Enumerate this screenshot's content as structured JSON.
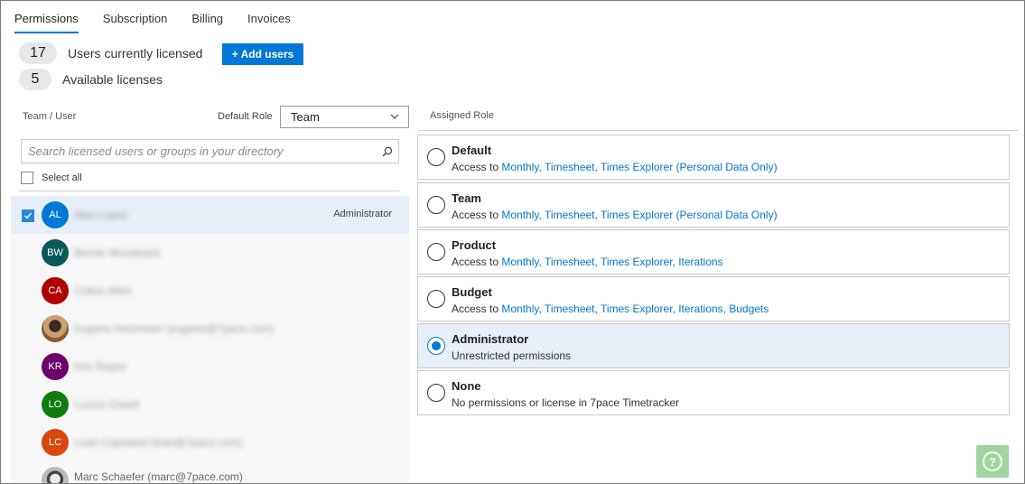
{
  "tabs": [
    {
      "label": "Permissions",
      "active": true
    },
    {
      "label": "Subscription",
      "active": false
    },
    {
      "label": "Billing",
      "active": false
    },
    {
      "label": "Invoices",
      "active": false
    }
  ],
  "licenses": {
    "licensed_count": "17",
    "licensed_label": "Users currently licensed",
    "available_count": "5",
    "available_label": "Available licenses",
    "add_users_label": "+ Add users"
  },
  "left_panel": {
    "team_user_header": "Team / User",
    "default_role_label": "Default Role",
    "default_role_value": "Team",
    "search_placeholder": "Search licensed users or groups in your directory",
    "select_all_label": "Select all"
  },
  "users": [
    {
      "initials": "AL",
      "name": "Alex Lopez",
      "role": "Administrator",
      "color": "#0078d4",
      "selected": true,
      "photo": ""
    },
    {
      "initials": "BW",
      "name": "Bernie Woodward",
      "role": "",
      "color": "#0b5a5a",
      "selected": false,
      "photo": ""
    },
    {
      "initials": "CA",
      "name": "Colton Allen",
      "role": "",
      "color": "#b00000",
      "selected": false,
      "photo": ""
    },
    {
      "initials": "",
      "name": "Eugene Holzmeier (eugene@7pace.com)",
      "role": "",
      "color": "#c9a070",
      "selected": false,
      "photo": "photo"
    },
    {
      "initials": "KR",
      "name": "Kim Raylor",
      "role": "",
      "color": "#6b006b",
      "selected": false,
      "photo": ""
    },
    {
      "initials": "LO",
      "name": "Lucius Orwell",
      "role": "",
      "color": "#107c10",
      "selected": false,
      "photo": ""
    },
    {
      "initials": "LC",
      "name": "Leah Copeland (leah@7pace.com)",
      "role": "",
      "color": "#d9480f",
      "selected": false,
      "photo": ""
    },
    {
      "initials": "",
      "name": "Marc Schaefer (marc@7pace.com)",
      "role": "",
      "color": "#444444",
      "selected": false,
      "photo": "photo2"
    }
  ],
  "right_panel": {
    "assigned_role_header": "Assigned Role",
    "roles": [
      {
        "name": "Default",
        "prefix": "Access to ",
        "links": "Monthly, Timesheet, Times Explorer (Personal Data Only)",
        "selected": false
      },
      {
        "name": "Team",
        "prefix": "Access to ",
        "links": "Monthly, Timesheet, Times Explorer (Personal Data Only)",
        "selected": false
      },
      {
        "name": "Product",
        "prefix": "Access to ",
        "links": "Monthly, Timesheet, Times Explorer, Iterations",
        "selected": false
      },
      {
        "name": "Budget",
        "prefix": "Access to ",
        "links": "Monthly, Timesheet, Times Explorer, Iterations, Budgets",
        "selected": false
      },
      {
        "name": "Administrator",
        "prefix": "Unrestricted permissions",
        "links": "",
        "selected": true
      },
      {
        "name": "None",
        "prefix": "No permissions or license in 7pace Timetracker",
        "links": "",
        "selected": false
      }
    ]
  },
  "help": {
    "icon": "question-icon",
    "symbol": "?"
  },
  "colors": {
    "accent": "#0078d4",
    "selected_bg": "#e6eef8",
    "help_bg": "#8fcf8f"
  }
}
